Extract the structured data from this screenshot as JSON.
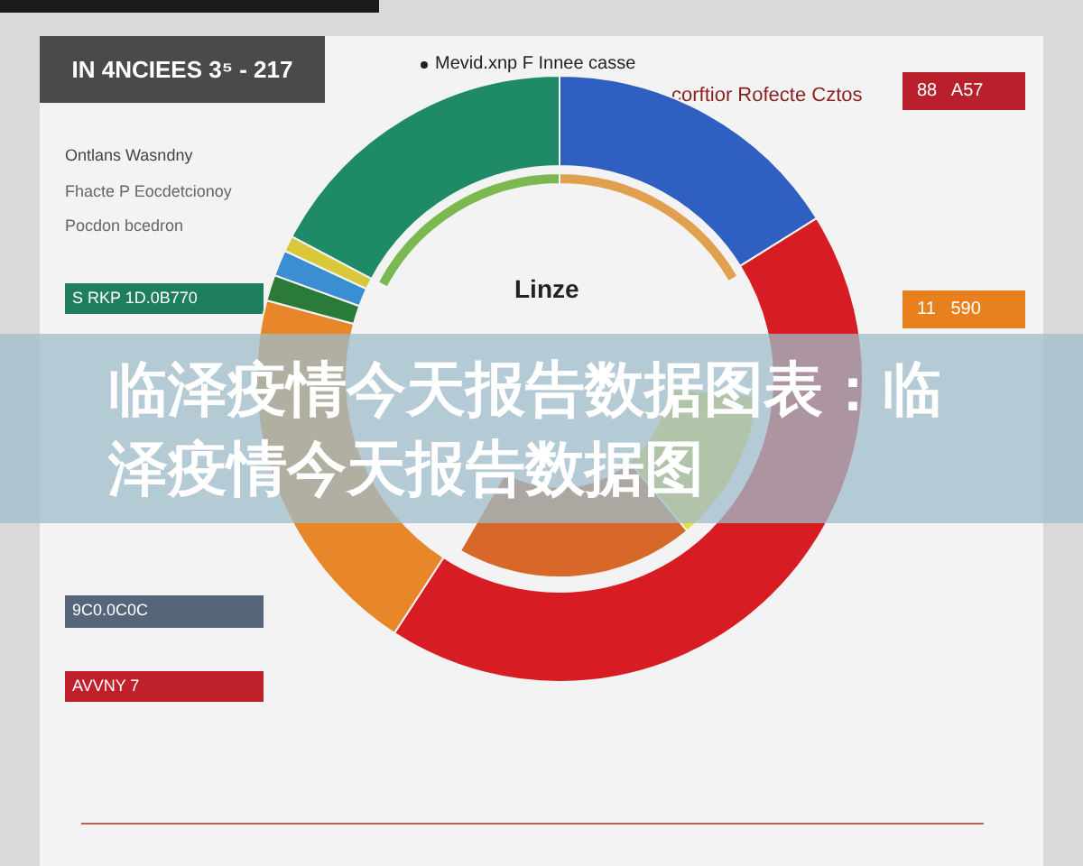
{
  "header": {
    "title": "IN 4NCIEES 3⁵ - 217"
  },
  "legend": {
    "label": "Mevid.xnp F Innee casse"
  },
  "callout": {
    "label": "corftior Rofecte Cztos"
  },
  "center_label": "Linze",
  "left_panel": {
    "heading": "Ontlans Wasndny",
    "lines": [
      "Fhacte P Eocdetcionoy",
      "Pocdon bcedron"
    ],
    "bars": [
      {
        "text": "S RKP 1D.0B770",
        "color": "#1f7f5c"
      },
      {
        "text": "9C0.0C0C",
        "color": "#56657a"
      },
      {
        "text": "AVVNY 7",
        "color": "#c0202c"
      }
    ]
  },
  "right_panel": {
    "badges": [
      {
        "text": "88   A57",
        "color": "#b8202c"
      },
      {
        "text": "11   590",
        "color": "#e8801e"
      }
    ]
  },
  "caption": "临泽疫情今天报告数据图表：临泽疫情今天报告数据图"
}
